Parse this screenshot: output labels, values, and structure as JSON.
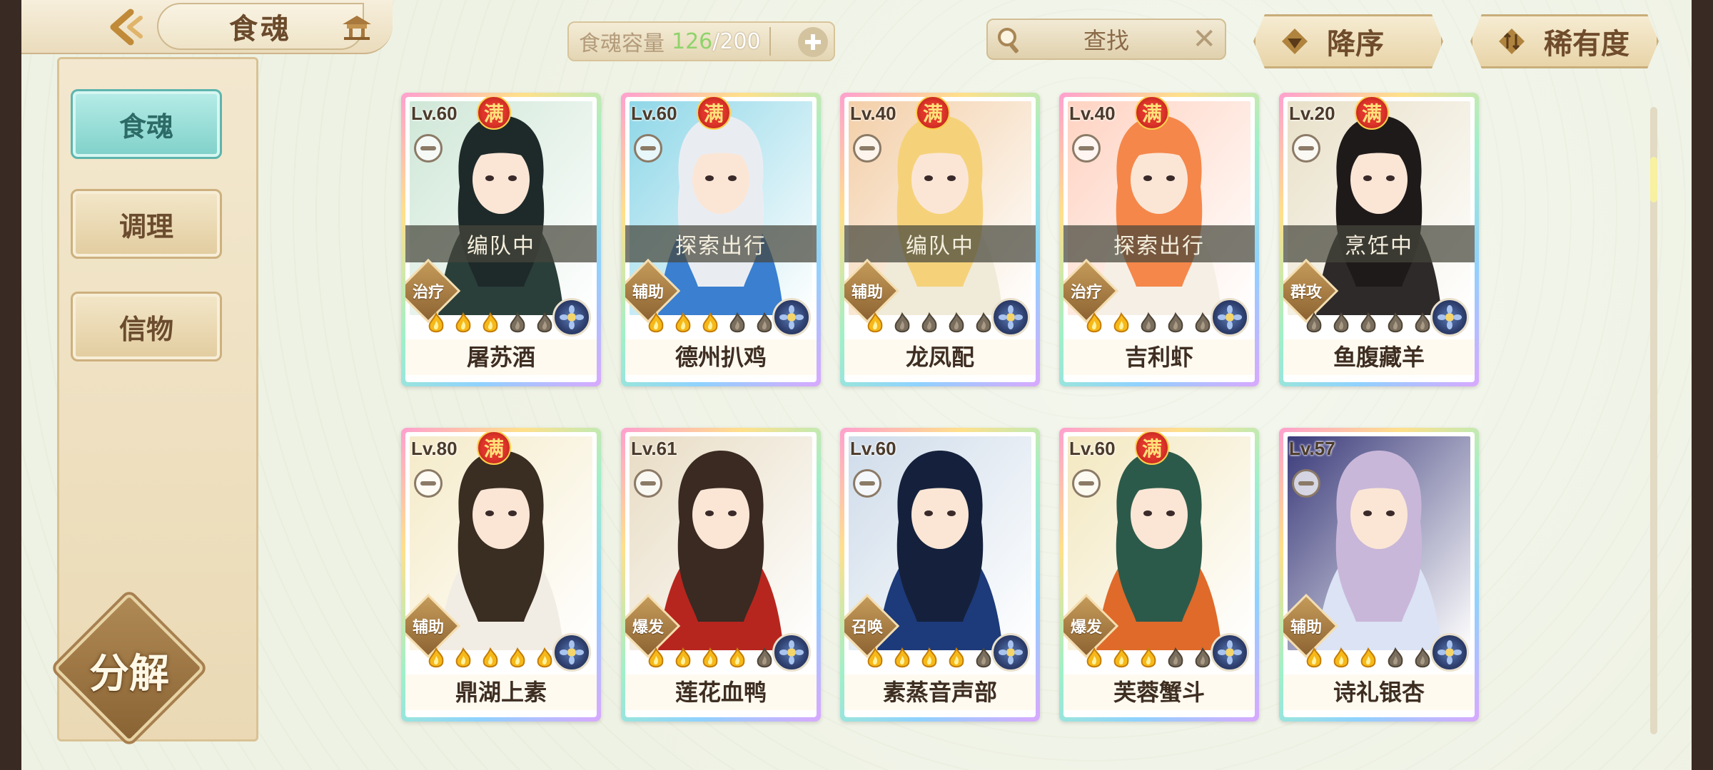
{
  "header": {
    "title": "食魂",
    "capacity_label": "食魂容量",
    "capacity_current": "126",
    "capacity_max": "/200",
    "search_label": "查找",
    "sort_desc_label": "降序",
    "sort_rarity_label": "稀有度"
  },
  "sidebar": {
    "tabs": [
      {
        "label": "食魂",
        "active": true
      },
      {
        "label": "调理",
        "active": false
      },
      {
        "label": "信物",
        "active": false
      }
    ],
    "decompose_label": "分解"
  },
  "cards": [
    {
      "level": "Lv.60",
      "full": "满",
      "status": "编队中",
      "role": "治疗",
      "stars": 3,
      "name": "屠苏酒",
      "palette": [
        "#cfe7d7",
        "#1e2a2a",
        "#2a3f3a"
      ]
    },
    {
      "level": "Lv.60",
      "full": "满",
      "status": "探索出行",
      "role": "辅助",
      "stars": 3,
      "name": "德州扒鸡",
      "palette": [
        "#8fd7e8",
        "#e9edf2",
        "#3a7fd0"
      ]
    },
    {
      "level": "Lv.40",
      "full": "满",
      "status": "编队中",
      "role": "辅助",
      "stars": 1,
      "name": "龙凤配",
      "palette": [
        "#f3cfa8",
        "#f5d27a",
        "#f0ead8"
      ]
    },
    {
      "level": "Lv.40",
      "full": "满",
      "status": "探索出行",
      "role": "治疗",
      "stars": 2,
      "name": "吉利虾",
      "palette": [
        "#ffd3c2",
        "#f5874a",
        "#f6efe6"
      ]
    },
    {
      "level": "Lv.20",
      "full": "满",
      "status": "烹饪中",
      "role": "群攻",
      "stars": 0,
      "name": "鱼腹藏羊",
      "palette": [
        "#e8e0c8",
        "#1f1a1a",
        "#2e2a2a"
      ]
    },
    {
      "level": "Lv.80",
      "full": "满",
      "status": "",
      "role": "辅助",
      "stars": 5,
      "name": "鼎湖上素",
      "palette": [
        "#f5ebc9",
        "#3a2d22",
        "#f2ede4"
      ]
    },
    {
      "level": "Lv.61",
      "full": "",
      "status": "",
      "role": "爆发",
      "stars": 4,
      "name": "莲花血鸭",
      "palette": [
        "#e8dcc4",
        "#3a2a22",
        "#b7261e"
      ]
    },
    {
      "level": "Lv.60",
      "full": "",
      "status": "",
      "role": "召唤",
      "stars": 4,
      "name": "素蒸音声部",
      "palette": [
        "#cfdcea",
        "#15213c",
        "#1d3a7a"
      ]
    },
    {
      "level": "Lv.60",
      "full": "满",
      "status": "",
      "role": "爆发",
      "stars": 3,
      "name": "芙蓉蟹斗",
      "palette": [
        "#f3e8c0",
        "#2c5a4a",
        "#e06a2a"
      ]
    },
    {
      "level": "Lv.57",
      "full": "",
      "status": "",
      "role": "辅助",
      "stars": 3,
      "name": "诗礼银杏",
      "palette": [
        "#3a3a7a",
        "#c9b7d9",
        "#dbe3f5"
      ]
    }
  ]
}
